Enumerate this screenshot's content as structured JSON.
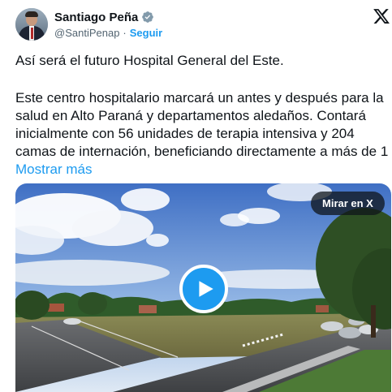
{
  "author": {
    "display_name": "Santiago Peña",
    "handle": "@SantiPenap",
    "separator": "·",
    "follow_label": "Seguir",
    "verified_color": "#829aab"
  },
  "platform_logo_icon": "x-logo-icon",
  "post": {
    "line1": "Así será el futuro Hospital General del Este.",
    "body": "Este centro hospitalario marcará un antes y después para la salud en Alto Paraná y departamentos aledaños. Contará inicialmente con 56 unidades de terapia intensiva y 204 camas de internación, beneficiando directamente a más de 1 ",
    "show_more_label": "Mostrar más"
  },
  "media": {
    "type": "video",
    "view_on_x_label": "Mirar en X",
    "play_icon": "play-icon"
  },
  "colors": {
    "accent": "#1d9bf0",
    "text": "#0f1419",
    "secondary": "#536471"
  }
}
